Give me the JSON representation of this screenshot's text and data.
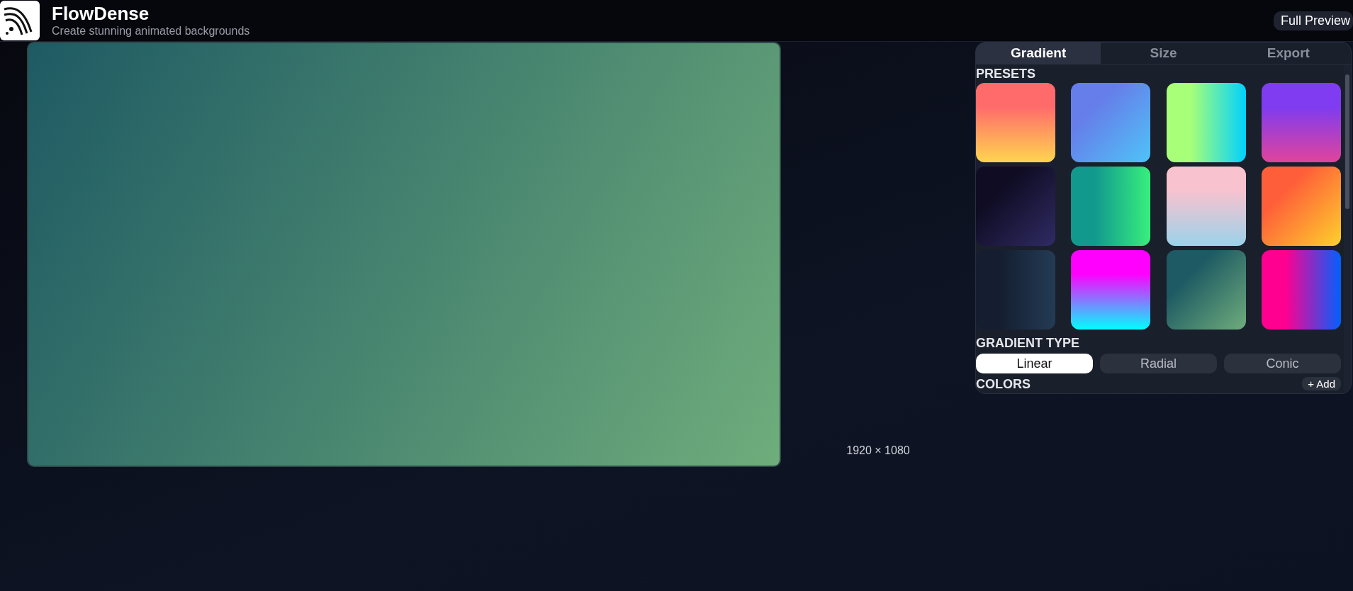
{
  "app": {
    "title": "FlowDense",
    "subtitle": "Create stunning animated backgrounds"
  },
  "full_preview_button": "Full Preview",
  "preview": {
    "size_label": "1920 × 1080"
  },
  "tabs": [
    {
      "label": "Gradient",
      "selected": true
    },
    {
      "label": "Size",
      "selected": false
    },
    {
      "label": "Export",
      "selected": false
    }
  ],
  "presets": {
    "heading": "PRESETS",
    "items": [
      {
        "color": "#ff6b6b"
      },
      {
        "color": "#667eea"
      },
      {
        "color": "#a8ff78"
      },
      {
        "color": "#7f3cf0"
      },
      {
        "color": "#0f0c24"
      },
      {
        "color": "#11998e"
      },
      {
        "color": "#f8c2cf"
      },
      {
        "color": "#ff5e3a"
      },
      {
        "color": "#141e30"
      },
      {
        "color": "#ff00ff"
      },
      {
        "color": "#1e5a63"
      },
      {
        "color": "#ff0090"
      }
    ]
  },
  "gradient_type": {
    "heading": "GRADIENT TYPE",
    "options": [
      {
        "label": "Linear",
        "selected": true
      },
      {
        "label": "Radial",
        "selected": false
      },
      {
        "label": "Conic",
        "selected": false
      }
    ]
  },
  "colors": {
    "heading": "COLORS",
    "add_button": "+ Add"
  }
}
